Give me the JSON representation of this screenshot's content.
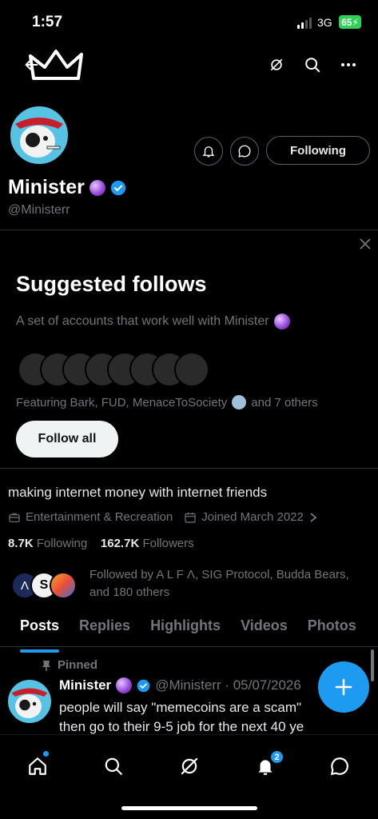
{
  "status_bar": {
    "time": "1:57",
    "network": "3G",
    "battery": "65"
  },
  "header": {
    "back_icon": "arrow-left-icon",
    "logo_icon": "crown-logo",
    "actions": [
      "grok-icon",
      "search-icon",
      "more-icon"
    ]
  },
  "profile": {
    "name": "Minister",
    "handle": "@Ministerr",
    "following_button": "Following",
    "bio": "making internet money with internet friends",
    "category": "Entertainment & Recreation",
    "joined": "Joined March 2022",
    "following_count": "8.7K",
    "following_label": "Following",
    "followers_count": "162.7K",
    "followers_label": "Followers",
    "followed_by": "Followed by A L F Λ, SIG Protocol, Budda Bears, and 180 others"
  },
  "suggested": {
    "title": "Suggested follows",
    "subtitle": "A set of accounts that work well with Minister",
    "featuring_prefix": "Featuring Bark, FUD, MenaceToSociety",
    "featuring_suffix": "and 7 others",
    "follow_all": "Follow all"
  },
  "tabs": [
    "Posts",
    "Replies",
    "Highlights",
    "Videos",
    "Photos"
  ],
  "post": {
    "pinned_label": "Pinned",
    "author": "Minister",
    "handle_date": "@Ministerr · 05/07/2026",
    "line1": "people will say \"memecoins are a scam\"",
    "line2": "then go to their 9-5 job for the next 40 ye"
  },
  "bottom_nav": {
    "items": [
      "home-icon",
      "search-icon",
      "grok-icon",
      "notifications-icon",
      "messages-icon"
    ],
    "notifications_badge": "2"
  },
  "colors": {
    "accent": "#1d9bf0",
    "background": "#000000",
    "muted": "#71767b"
  }
}
